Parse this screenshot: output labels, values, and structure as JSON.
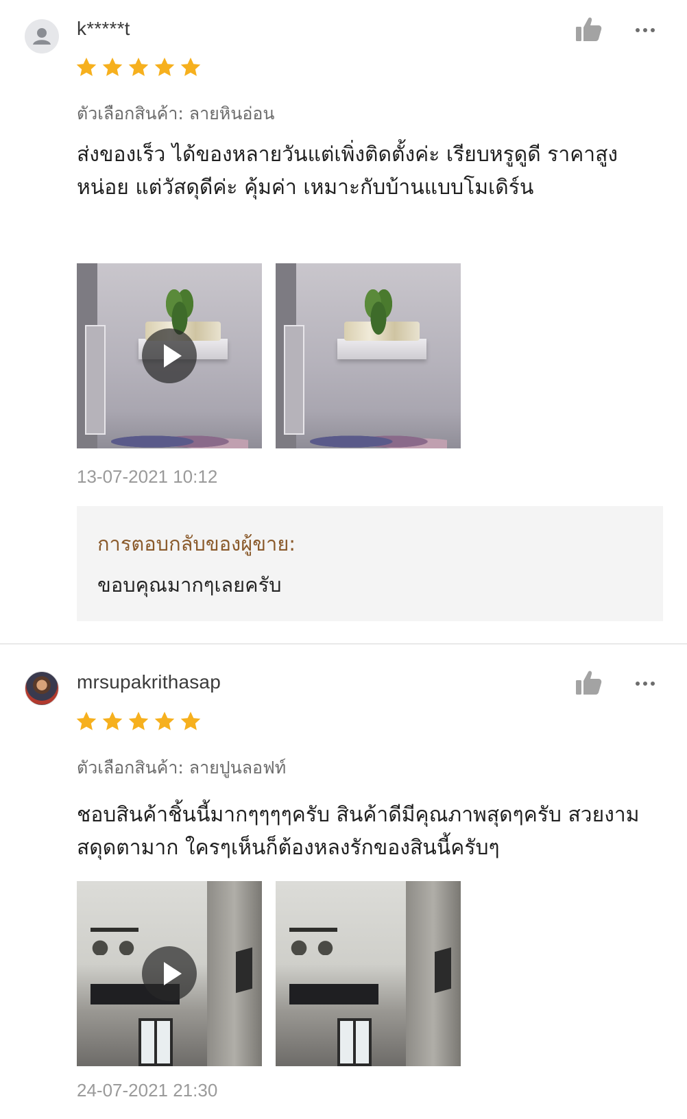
{
  "reviews": [
    {
      "username": "k*****t",
      "rating": 5,
      "variant": "ตัวเลือกสินค้า: ลายหินอ่อน",
      "text": "ส่งของเร็ว ได้ของหลายวันแต่เพิ่งติดตั้งค่ะ เรียบหรูดูดี ราคาสูงหน่อย แต่วัสดุดีค่ะ คุ้มค่า เหมาะกับบ้านแบบโมเดิร์น",
      "date": "13-07-2021 10:12",
      "media": [
        {
          "type": "video",
          "icon": "play-icon"
        },
        {
          "type": "image"
        }
      ],
      "seller_reply": {
        "label": "การตอบกลับของผู้ขาย:",
        "text": "ขอบคุณมากๆเลยครับ"
      }
    },
    {
      "username": "mrsupakrithasap",
      "rating": 5,
      "variant": "ตัวเลือกสินค้า: ลายปูนลอฟท์",
      "text": "ชอบสินค้าชิ้นนี้มากๆๆๆๆครับ สินค้าดีมีคุณภาพสุดๆครับ สวยงามสดุดตามาก ใครๆเห็นก็ต้องหลงรักของสินนี้ครับๆ",
      "date": "24-07-2021 21:30",
      "media": [
        {
          "type": "video",
          "icon": "play-icon"
        },
        {
          "type": "image"
        }
      ]
    }
  ],
  "icons": {
    "like": "thumbs-up-icon",
    "more": "more-dots-icon",
    "star": "star-icon",
    "avatar_default": "user-icon"
  },
  "colors": {
    "star": "#f6b01e",
    "icon_gray": "#9d9d9d",
    "seller_label": "#8a5a2b",
    "reply_bg": "#f4f4f4",
    "date_gray": "#9a9a9a"
  }
}
